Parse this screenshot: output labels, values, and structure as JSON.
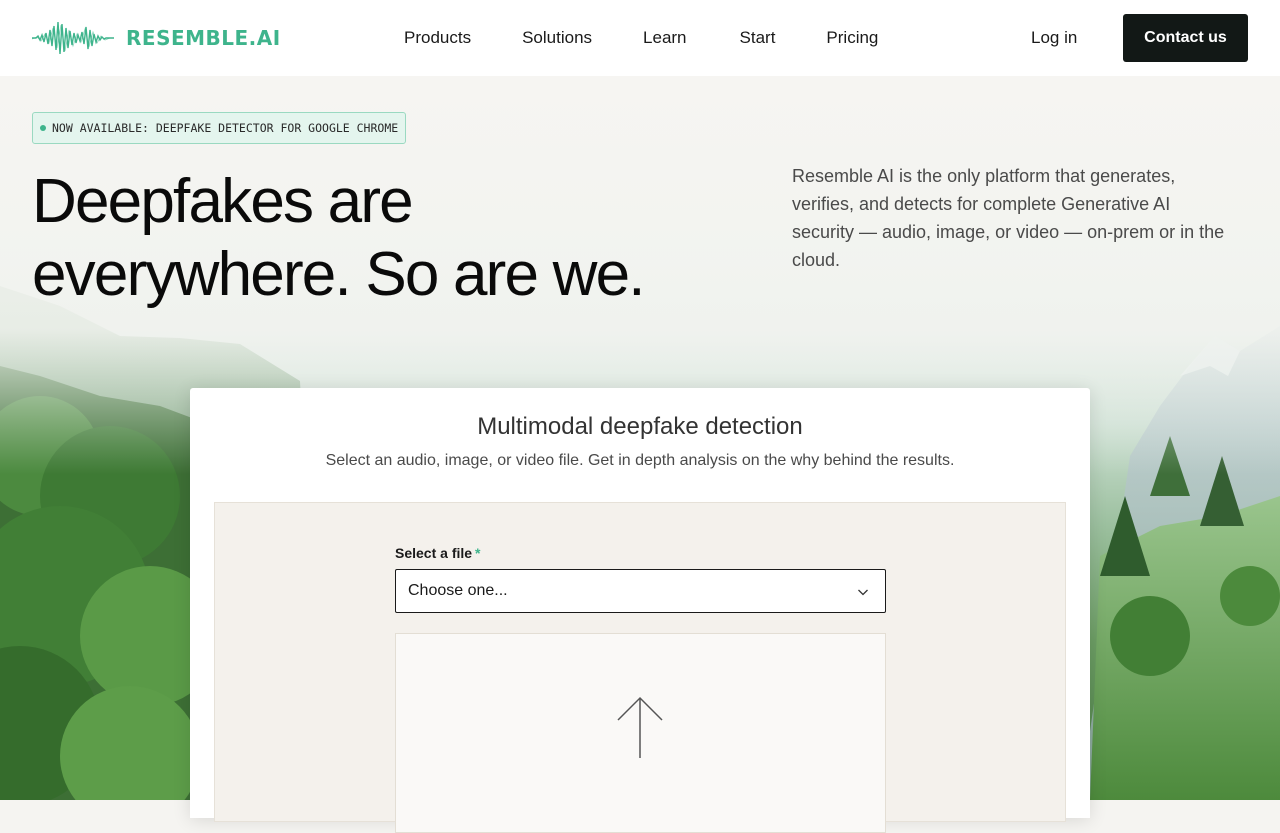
{
  "header": {
    "logo_text": "RESEMBLE.AI",
    "nav": [
      {
        "label": "Products"
      },
      {
        "label": "Solutions"
      },
      {
        "label": "Learn"
      },
      {
        "label": "Start"
      },
      {
        "label": "Pricing"
      }
    ],
    "login_label": "Log in",
    "contact_label": "Contact us"
  },
  "hero": {
    "badge": "NOW AVAILABLE: DEEPFAKE DETECTOR FOR GOOGLE CHROME",
    "headline_line1": "Deepfakes are",
    "headline_line2": "everywhere. So are we.",
    "intro": "Resemble AI is the only platform that generates, verifies, and detects for complete Generative AI security — audio, image, or video — on-prem or in the cloud."
  },
  "card": {
    "title": "Multimodal deepfake detection",
    "subtitle": "Select an audio, image, or video file. Get in depth analysis on the why behind the results.",
    "field_label": "Select a file",
    "required_mark": "*",
    "select_value": "Choose one..."
  },
  "icons": {
    "logo_wave": "waveform-icon",
    "chevron": "chevron-down-icon",
    "upload": "upload-arrow-icon"
  },
  "colors": {
    "brand": "#3eb48c",
    "button_dark": "#121816"
  }
}
